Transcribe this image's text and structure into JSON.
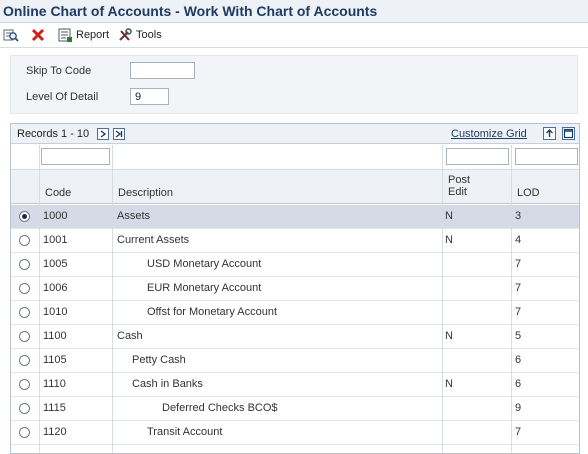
{
  "title": "Online Chart of Accounts - Work With Chart of Accounts",
  "toolbar": {
    "report_label": "Report",
    "tools_label": "Tools"
  },
  "form": {
    "skip_label": "Skip To Code",
    "skip_value": "",
    "level_label": "Level Of Detail",
    "level_value": "9"
  },
  "grid": {
    "records_label": "Records 1 - 10",
    "customize_label": "Customize Grid",
    "columns": {
      "code": "Code",
      "description": "Description",
      "post_edit_line1": "Post",
      "post_edit_line2": "Edit",
      "lod": "LOD"
    },
    "rows": [
      {
        "code": "1000",
        "description": "Assets",
        "indent": 0,
        "post_edit": "N",
        "lod": "3",
        "selected": true
      },
      {
        "code": "1001",
        "description": "Current Assets",
        "indent": 0,
        "post_edit": "N",
        "lod": "4",
        "selected": false
      },
      {
        "code": "1005",
        "description": "USD Monetary Account",
        "indent": 2,
        "post_edit": "",
        "lod": "7",
        "selected": false
      },
      {
        "code": "1006",
        "description": "EUR Monetary Account",
        "indent": 2,
        "post_edit": "",
        "lod": "7",
        "selected": false
      },
      {
        "code": "1010",
        "description": "Offst for Monetary Account",
        "indent": 2,
        "post_edit": "",
        "lod": "7",
        "selected": false
      },
      {
        "code": "1100",
        "description": "Cash",
        "indent": 0,
        "post_edit": "N",
        "lod": "5",
        "selected": false
      },
      {
        "code": "1105",
        "description": "Petty Cash",
        "indent": 1,
        "post_edit": "",
        "lod": "6",
        "selected": false
      },
      {
        "code": "1110",
        "description": "Cash in Banks",
        "indent": 1,
        "post_edit": "N",
        "lod": "6",
        "selected": false
      },
      {
        "code": "1115",
        "description": "Deferred Checks BCO$",
        "indent": 3,
        "post_edit": "",
        "lod": "9",
        "selected": false
      },
      {
        "code": "1120",
        "description": "Transit Account",
        "indent": 2,
        "post_edit": "",
        "lod": "7",
        "selected": false
      }
    ]
  }
}
